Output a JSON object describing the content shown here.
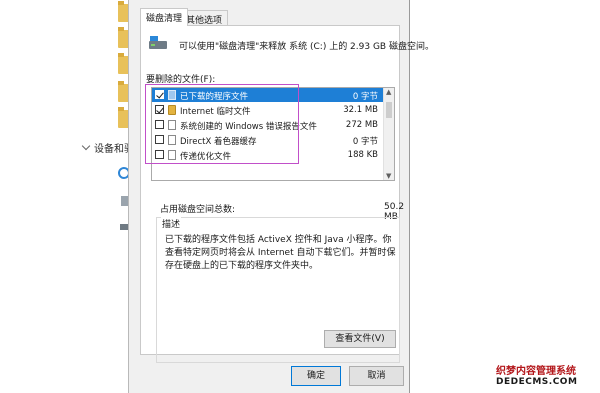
{
  "background": {
    "devices_label": "设备和驱"
  },
  "dialog": {
    "tabs": [
      "磁盘清理",
      "其他选项"
    ],
    "intro": "可以使用\"磁盘清理\"来释放 系统 (C:) 上的 2.93 GB 磁盘空间。",
    "files_label": "要删除的文件(F):",
    "files": [
      {
        "name": "已下载的程序文件",
        "size": "0 字节",
        "checked": true,
        "selected": true,
        "icon": "folder-icon"
      },
      {
        "name": "Internet 临时文件",
        "size": "32.1 MB",
        "checked": true,
        "selected": false,
        "icon": "lock-icon"
      },
      {
        "name": "系统创建的 Windows 错误报告文件",
        "size": "272 MB",
        "checked": false,
        "selected": false,
        "icon": "file-icon"
      },
      {
        "name": "DirectX 着色器缓存",
        "size": "0 字节",
        "checked": false,
        "selected": false,
        "icon": "file-icon"
      },
      {
        "name": "传递优化文件",
        "size": "188 KB",
        "checked": false,
        "selected": false,
        "icon": "file-icon"
      }
    ],
    "space_gain_label": "占用磁盘空间总数:",
    "space_gain_value": "50.2 MB",
    "description_title": "描述",
    "description_text": "已下载的程序文件包括 ActiveX 控件和 Java 小程序。你查看特定网页时将会从 Internet 自动下载它们。并暂时保存在硬盘上的已下载的程序文件夹中。",
    "view_files_button": "查看文件(V)",
    "ok_button": "确定",
    "cancel_button": "取消"
  },
  "watermark": {
    "line1": "织梦内容管理系统",
    "line2": "DEDECMS.COM"
  },
  "colors": {
    "selection": "#1e7fd6",
    "highlight_box": "#c14fc9",
    "dialog_bg": "#f0f0f0"
  }
}
